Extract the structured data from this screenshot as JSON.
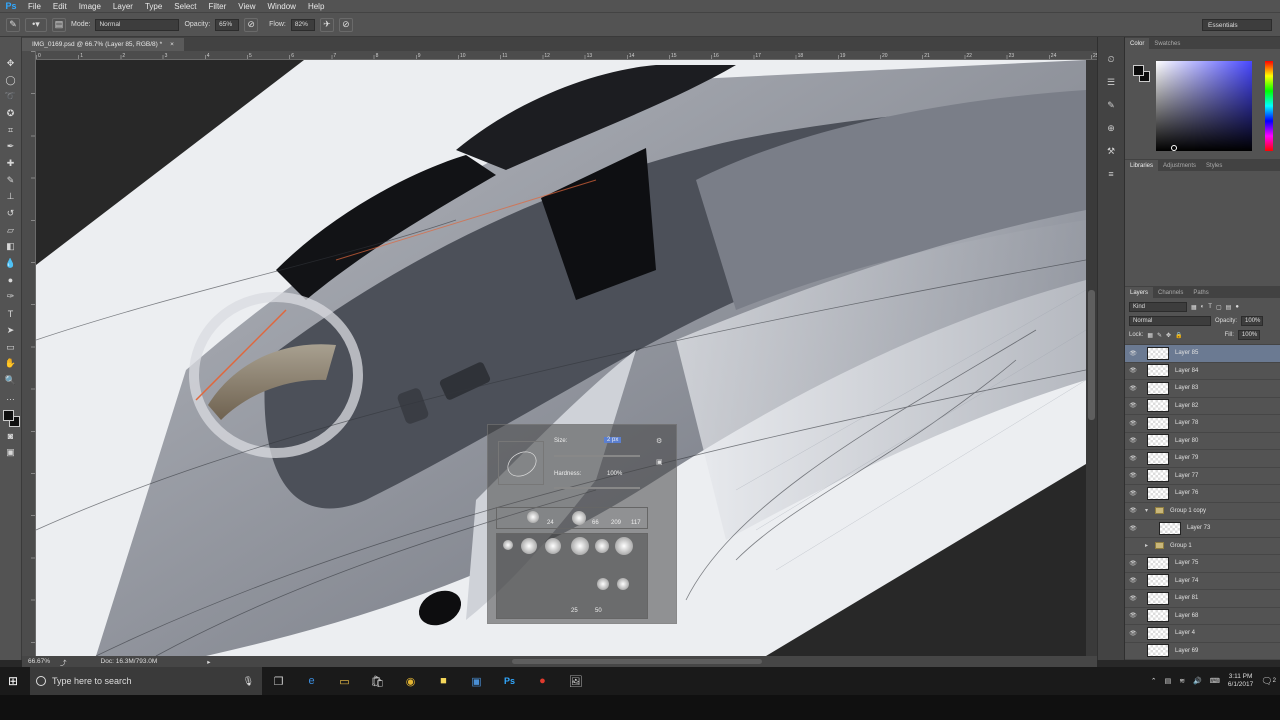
{
  "menubar": {
    "app_logo": "Ps",
    "items": [
      "File",
      "Edit",
      "Image",
      "Layer",
      "Type",
      "Select",
      "Filter",
      "View",
      "Window",
      "Help"
    ]
  },
  "options": {
    "mode_label": "Mode:",
    "mode_value": "Normal",
    "opacity_label": "Opacity:",
    "opacity_value": "65%",
    "flow_label": "Flow:",
    "flow_value": "82%",
    "workspace": "Essentials"
  },
  "document": {
    "tab_title": "IMG_0169.psd @ 66.7% (Layer 85, RGB/8) *",
    "zoom": "66.67%",
    "doc_info": "Doc: 16.3M/793.0M"
  },
  "ruler_ticks": [
    "0",
    "1",
    "2",
    "3",
    "4",
    "5",
    "6",
    "7",
    "8",
    "9",
    "10",
    "11",
    "12",
    "13",
    "14",
    "15",
    "16",
    "17",
    "18",
    "19",
    "20",
    "21",
    "22",
    "23",
    "24",
    "25"
  ],
  "color_panel": {
    "tabs": [
      "Color",
      "Swatches"
    ],
    "active_tab": "Color"
  },
  "libraries_panel": {
    "tabs": [
      "Libraries",
      "Adjustments",
      "Styles"
    ],
    "active_tab": "Libraries"
  },
  "layers_panel": {
    "tabs": [
      "Layers",
      "Channels",
      "Paths"
    ],
    "active_tab": "Layers",
    "filter": "Kind",
    "blend_mode": "Normal",
    "opacity_label": "Opacity:",
    "opacity_value": "100%",
    "lock_label": "Lock:",
    "fill_label": "Fill:",
    "fill_value": "100%",
    "layers": [
      {
        "name": "Layer 85",
        "selected": true
      },
      {
        "name": "Layer 84"
      },
      {
        "name": "Layer 83"
      },
      {
        "name": "Layer 82"
      },
      {
        "name": "Layer 78"
      },
      {
        "name": "Layer 80"
      },
      {
        "name": "Layer 79"
      },
      {
        "name": "Layer 77"
      },
      {
        "name": "Layer 76"
      },
      {
        "name": "Group 1 copy",
        "group": true,
        "expanded": true
      },
      {
        "name": "Layer 73",
        "indent": true
      },
      {
        "name": "Group 1",
        "group": true,
        "hidden": true
      },
      {
        "name": "Layer 75"
      },
      {
        "name": "Layer 74"
      },
      {
        "name": "Layer 81"
      },
      {
        "name": "Layer 68"
      },
      {
        "name": "Layer 4"
      },
      {
        "name": "Layer 69",
        "hidden": true
      }
    ]
  },
  "brush_picker": {
    "size_label": "Size:",
    "size_value": "2 px",
    "hardness_label": "Hardness:",
    "hardness_value": "100%",
    "preset_sizes": [
      "24",
      "",
      "66",
      "209",
      "117"
    ],
    "more_sizes": [
      "25",
      "50"
    ]
  },
  "taskbar": {
    "search_placeholder": "Type here to search",
    "time": "3:11 PM",
    "date": "6/1/2017",
    "notifications": "2"
  }
}
